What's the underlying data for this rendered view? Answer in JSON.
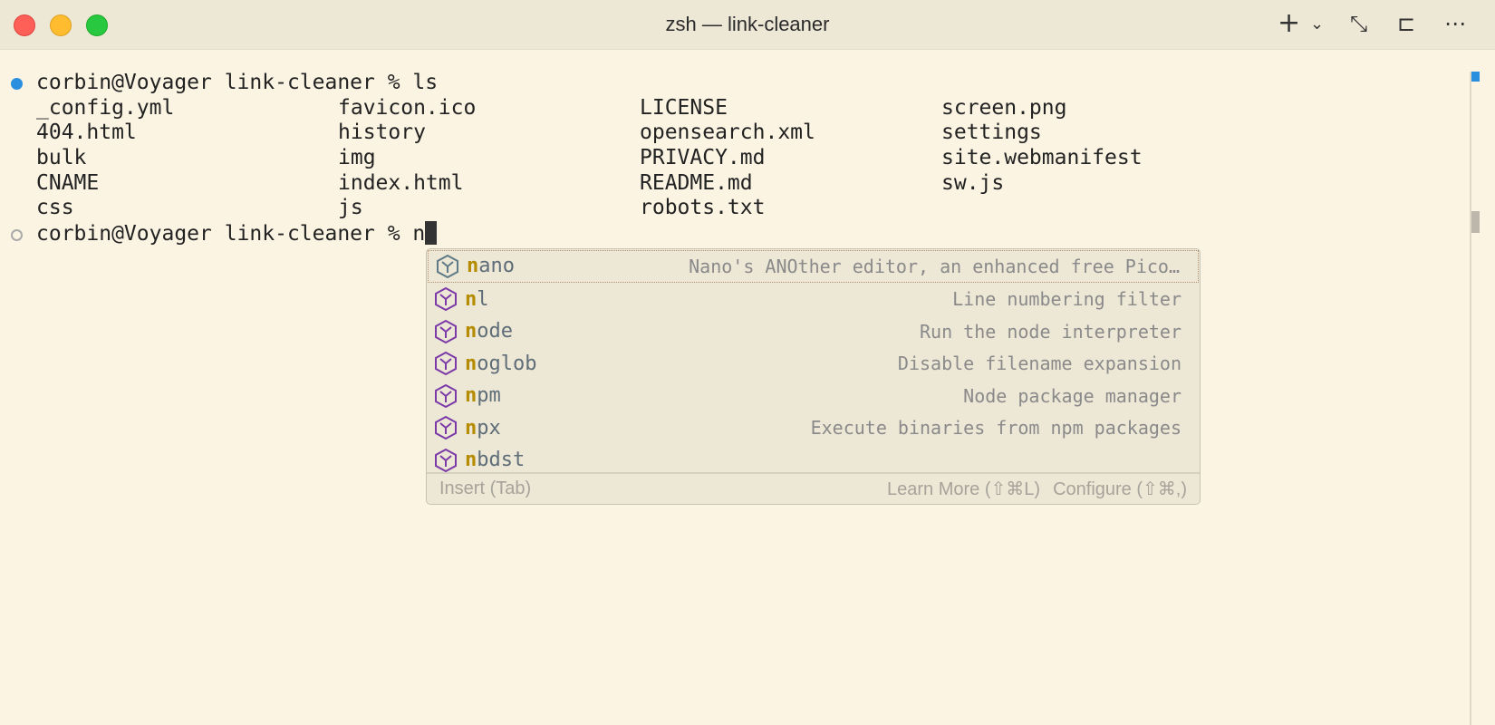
{
  "window": {
    "title": "zsh — link-cleaner"
  },
  "toolbar": {
    "new_tab": "+",
    "dropdown": "⌄",
    "collapse": "⤡",
    "pin": "⊏",
    "more": "⋯"
  },
  "terminal": {
    "prompt1": "corbin@Voyager link-cleaner % ls",
    "ls_rows": [
      [
        "_config.yml",
        "favicon.ico",
        "LICENSE",
        "screen.png"
      ],
      [
        "404.html",
        "history",
        "opensearch.xml",
        "settings"
      ],
      [
        "bulk",
        "img",
        "PRIVACY.md",
        "site.webmanifest"
      ],
      [
        "CNAME",
        "index.html",
        "README.md",
        "sw.js"
      ],
      [
        "css",
        "js",
        "robots.txt",
        ""
      ]
    ],
    "prompt2": "corbin@Voyager link-cleaner % n"
  },
  "autocomplete": {
    "typed": "n",
    "items": [
      {
        "rest": "ano",
        "desc": "Nano's ANOther editor, an enhanced free Pico…"
      },
      {
        "rest": "l",
        "desc": "Line numbering filter"
      },
      {
        "rest": "ode",
        "desc": "Run the node interpreter"
      },
      {
        "rest": "oglob",
        "desc": "Disable filename expansion"
      },
      {
        "rest": "pm",
        "desc": "Node package manager"
      },
      {
        "rest": "px",
        "desc": "Execute binaries from npm packages"
      },
      {
        "rest": "bdst",
        "desc": ""
      }
    ],
    "footer": {
      "insert": "Insert (Tab)",
      "learn_more": "Learn More (⇧⌘L)",
      "configure": "Configure (⇧⌘,)"
    }
  },
  "colors": {
    "accent": "#2a8fde",
    "match": "#b58b00",
    "icon": "#7b3aa8"
  }
}
